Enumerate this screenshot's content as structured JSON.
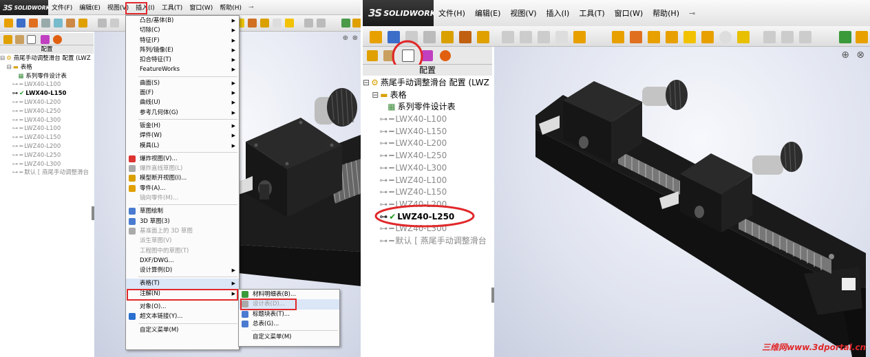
{
  "left": {
    "logo": "SOLIDWORKS",
    "menubar": [
      "文件(F)",
      "编辑(E)",
      "视图(V)",
      "插入(I)",
      "工具(T)",
      "窗口(W)",
      "帮助(H)"
    ],
    "panel_title": "配置",
    "tree": {
      "root": "燕尾手动调整滑台 配置 (LWZ",
      "tables_folder": "表格",
      "design_table": "系列零件设计表",
      "configs": [
        {
          "label": "LWX40-L100",
          "active": false
        },
        {
          "label": "LWX40-L150",
          "active": true
        },
        {
          "label": "LWX40-L200",
          "active": false
        },
        {
          "label": "LWX40-L250",
          "active": false
        },
        {
          "label": "LWX40-L300",
          "active": false
        },
        {
          "label": "LWZ40-L100",
          "active": false
        },
        {
          "label": "LWZ40-L150",
          "active": false
        },
        {
          "label": "LWZ40-L200",
          "active": false
        },
        {
          "label": "LWZ40-L250",
          "active": false
        },
        {
          "label": "LWZ40-L300",
          "active": false
        }
      ],
      "default": "默认 [ 燕尾手动调整滑台"
    },
    "insert_menu": [
      {
        "label": "凸台/基体(B)",
        "sub": true
      },
      {
        "label": "切除(C)",
        "sub": true
      },
      {
        "label": "特征(F)",
        "sub": true
      },
      {
        "label": "阵列/镜像(E)",
        "sub": true
      },
      {
        "label": "扣合特征(T)",
        "sub": true
      },
      {
        "label": "FeatureWorks",
        "sub": true
      },
      {
        "sep": true
      },
      {
        "label": "曲面(S)",
        "sub": true
      },
      {
        "label": "面(F)",
        "sub": true
      },
      {
        "label": "曲线(U)",
        "sub": true
      },
      {
        "label": "参考几何体(G)",
        "sub": true
      },
      {
        "sep": true
      },
      {
        "label": "钣金(H)",
        "sub": true
      },
      {
        "label": "焊件(W)",
        "sub": true
      },
      {
        "label": "模具(L)",
        "sub": true
      },
      {
        "sep": true
      },
      {
        "label": "爆炸视图(V)...",
        "icon": "#d33"
      },
      {
        "label": "爆炸直线草图(L)",
        "dis": true,
        "icon": "#aaa"
      },
      {
        "label": "模型断开视图(I)...",
        "icon": "#d9a000"
      },
      {
        "label": "零件(A)...",
        "icon": "#e0a000"
      },
      {
        "label": "镜向零件(M)...",
        "dis": true
      },
      {
        "sep": true
      },
      {
        "label": "草图绘制",
        "icon": "#4a7bd0"
      },
      {
        "label": "3D 草图(3)",
        "icon": "#4a7bd0"
      },
      {
        "label": "基准面上的 3D 草图",
        "dis": true,
        "icon": "#aaa"
      },
      {
        "label": "派生草图(V)",
        "dis": true
      },
      {
        "label": "工程图中的草图(T)",
        "dis": true
      },
      {
        "label": "DXF/DWG..."
      },
      {
        "label": "设计算例(D)",
        "sub": true
      },
      {
        "sep": true
      },
      {
        "label": "表格(T)",
        "sub": true,
        "hl": true
      },
      {
        "label": "注解(N)",
        "sub": true
      },
      {
        "sep": true
      },
      {
        "label": "对象(O)..."
      },
      {
        "label": "超文本链接(Y)...",
        "icon": "#2a6fd0"
      },
      {
        "sep": true
      },
      {
        "label": "自定义菜单(M)"
      }
    ],
    "tables_submenu": [
      {
        "label": "材料明细表(B)...",
        "icon": "#3a9a3a"
      },
      {
        "label": "设计表(D)...",
        "dis": true,
        "icon": "#aaa",
        "hl": true
      },
      {
        "label": "标题块表(T)...",
        "icon": "#4a7bd0"
      },
      {
        "label": "总表(G)...",
        "icon": "#4a7bd0"
      },
      {
        "sep": true
      },
      {
        "label": "自定义菜单(M)"
      }
    ]
  },
  "right": {
    "logo": "SOLIDWORKS",
    "menubar": [
      "文件(H)",
      "编辑(E)",
      "视图(V)",
      "插入(I)",
      "工具(T)",
      "窗口(W)",
      "帮助(H)"
    ],
    "panel_title": "配置",
    "tree": {
      "root": "燕尾手动调整滑台 配置 (LWZ",
      "tables_folder": "表格",
      "design_table": "系列零件设计表",
      "configs": [
        {
          "label": "LWX40-L100",
          "active": false
        },
        {
          "label": "LWX40-L150",
          "active": false
        },
        {
          "label": "LWX40-L200",
          "active": false
        },
        {
          "label": "LWX40-L250",
          "active": false
        },
        {
          "label": "LWX40-L300",
          "active": false
        },
        {
          "label": "LWZ40-L100",
          "active": false
        },
        {
          "label": "LWZ40-L150",
          "active": false
        },
        {
          "label": "LWZ40-L200",
          "active": false
        },
        {
          "label": "LWZ40-L250",
          "active": true
        },
        {
          "label": "LWZ40-L300",
          "active": false
        }
      ],
      "default": "默认 [ 燕尾手动调整滑台"
    },
    "watermark": "三维网www.3dportal.cn"
  },
  "colors": {
    "highlight_red": "#e0282a",
    "inactive_gray": "#8a8a8a",
    "check_green": "#1a9a1a"
  }
}
